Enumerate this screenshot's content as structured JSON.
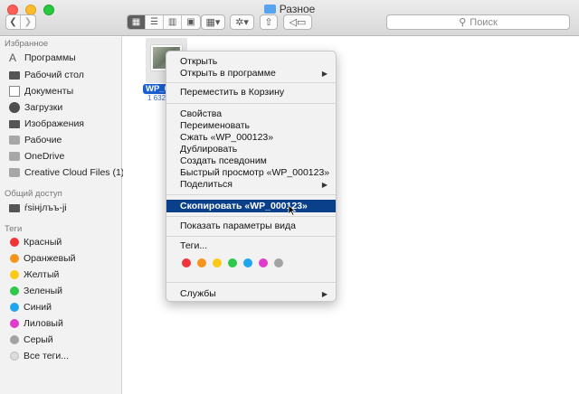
{
  "window": {
    "title": "Разное"
  },
  "toolbar": {
    "back_icon": "chevron-left",
    "forward_icon": "chevron-right",
    "search_placeholder": "Поиск"
  },
  "sidebar": {
    "favorites_header": "Избранное",
    "favorites": [
      {
        "label": "Программы",
        "icon": "apps-icon"
      },
      {
        "label": "Рабочий стол",
        "icon": "desktop-icon"
      },
      {
        "label": "Документы",
        "icon": "documents-icon"
      },
      {
        "label": "Загрузки",
        "icon": "downloads-icon"
      },
      {
        "label": "Изображения",
        "icon": "camera-icon"
      },
      {
        "label": "Рабочие",
        "icon": "folder-icon"
      },
      {
        "label": "OneDrive",
        "icon": "folder-icon"
      },
      {
        "label": "Creative Cloud Files (1)",
        "icon": "folder-icon"
      }
    ],
    "shared_header": "Общий доступ",
    "shared": [
      {
        "label": "ŕsiнјлъъ-јi",
        "icon": "display-icon"
      }
    ],
    "tags_header": "Теги",
    "tags": [
      {
        "label": "Красный",
        "color": "#f0343a"
      },
      {
        "label": "Оранжевый",
        "color": "#f7941d"
      },
      {
        "label": "Желтый",
        "color": "#fcca16"
      },
      {
        "label": "Зеленый",
        "color": "#2ec94b"
      },
      {
        "label": "Синий",
        "color": "#20a5ef"
      },
      {
        "label": "Лиловый",
        "color": "#e03ccb"
      },
      {
        "label": "Серый",
        "color": "#a3a3a3"
      },
      {
        "label": "Все теги...",
        "color": "#dcdcdc"
      }
    ]
  },
  "file": {
    "name": "WP_000",
    "meta": "1 632"
  },
  "context_menu": {
    "items": [
      {
        "label": "Открыть",
        "submenu": false
      },
      {
        "label": "Открыть в программе",
        "submenu": true
      },
      {
        "label": "Переместить в Корзину",
        "submenu": false
      },
      {
        "label": "Свойства",
        "submenu": false
      },
      {
        "label": "Переименовать",
        "submenu": false
      },
      {
        "label": "Сжать «WP_000123»",
        "submenu": false
      },
      {
        "label": "Дублировать",
        "submenu": false
      },
      {
        "label": "Создать псевдоним",
        "submenu": false
      },
      {
        "label": "Быстрый просмотр «WP_000123»",
        "submenu": false
      },
      {
        "label": "Поделиться",
        "submenu": true
      },
      {
        "label": "Скопировать «WP_000123»",
        "submenu": false,
        "highlighted": true
      },
      {
        "label": "Показать параметры вида",
        "submenu": false
      },
      {
        "label": "Теги...",
        "submenu": false
      },
      {
        "label": "Службы",
        "submenu": true
      }
    ],
    "tag_colors": [
      "#f0343a",
      "#f7941d",
      "#fcca16",
      "#2ec94b",
      "#20a5ef",
      "#e03ccb",
      "#a3a3a3"
    ]
  }
}
